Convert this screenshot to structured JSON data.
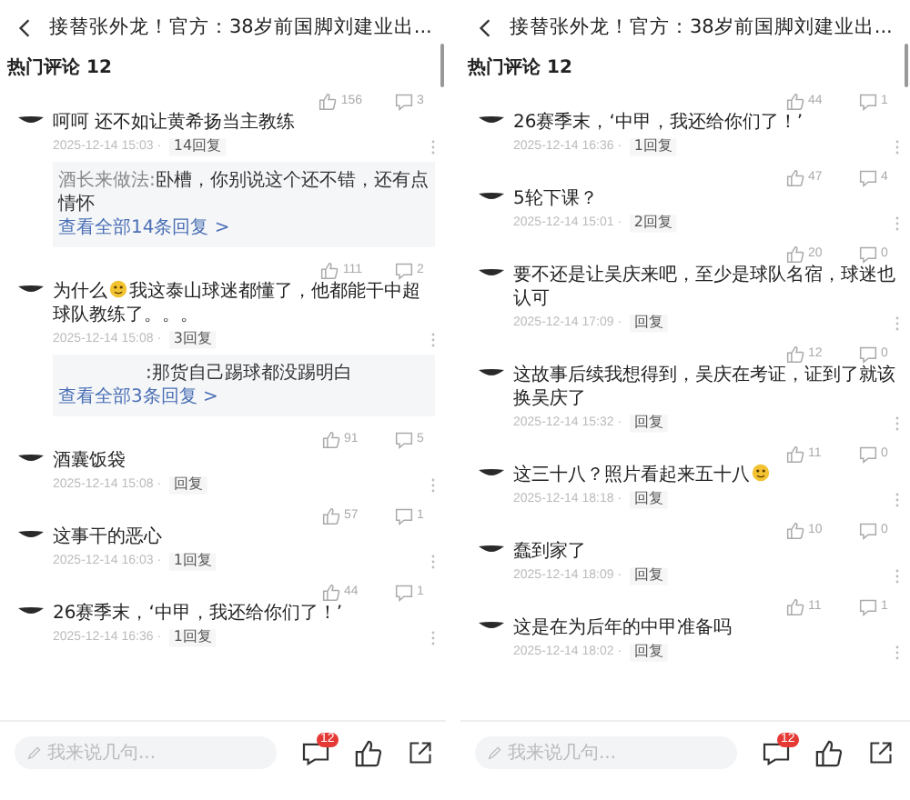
{
  "panels": [
    {
      "title": "接替张外龙！官方：38岁前国脚刘建业出...",
      "section": "热门评论 12",
      "comments": [
        {
          "likes": "156",
          "replies": "3",
          "text": "呵呵 还不如让黄希扬当主教练",
          "emoji": false,
          "date": "2025-12-14 15:03 ·",
          "reply_label": "14回复",
          "preview": {
            "author": "酒长来做法:",
            "text": "卧槽，你别说这个还不错，还有点情怀",
            "more": "查看全部14条回复 >"
          }
        },
        {
          "likes": "111",
          "replies": "2",
          "text": "为什么",
          "emoji": true,
          "text_after": "我这泰山球迷都懂了，他都能干中超球队教练了。。。",
          "date": "2025-12-14 15:08 ·",
          "reply_label": "3回复",
          "preview": {
            "text": ":那货自己踢球都没踢明白",
            "more": "查看全部3条回复 >"
          }
        },
        {
          "likes": "91",
          "replies": "5",
          "text": "酒囊饭袋",
          "emoji": false,
          "date": "2025-12-14 15:08 ·",
          "reply_label": "回复"
        },
        {
          "likes": "57",
          "replies": "1",
          "text": "这事干的恶心",
          "emoji": false,
          "date": "2025-12-14 16:03 ·",
          "reply_label": "1回复"
        },
        {
          "likes": "44",
          "replies": "1",
          "text": "26赛季末，‘中甲，我还给你们了！’",
          "emoji": false,
          "date": "2025-12-14 16:36 ·",
          "reply_label": "1回复"
        }
      ],
      "input": {
        "placeholder": "我来说几句..."
      },
      "badge": "12"
    },
    {
      "title": "接替张外龙！官方：38岁前国脚刘建业出...",
      "section": "热门评论 12",
      "comments": [
        {
          "likes": "44",
          "replies": "1",
          "text": "26赛季末，‘中甲，我还给你们了！’",
          "emoji": false,
          "date": "2025-12-14 16:36 ·",
          "reply_label": "1回复"
        },
        {
          "likes": "47",
          "replies": "4",
          "text": "5轮下课？",
          "emoji": false,
          "date": "2025-12-14 15:01 ·",
          "reply_label": "2回复"
        },
        {
          "likes": "20",
          "replies": "0",
          "text": "要不还是让吴庆来吧，至少是球队名宿，球迷也认可",
          "emoji": false,
          "date": "2025-12-14 17:09 ·",
          "reply_label": "回复"
        },
        {
          "likes": "12",
          "replies": "0",
          "text": "这故事后续我想得到，吴庆在考证，证到了就该换吴庆了",
          "emoji": false,
          "date": "2025-12-14 15:32 ·",
          "reply_label": "回复"
        },
        {
          "likes": "11",
          "replies": "0",
          "text": "这三十八？照片看起来五十八",
          "emoji": true,
          "date": "2025-12-14 18:18 ·",
          "reply_label": "回复"
        },
        {
          "likes": "10",
          "replies": "0",
          "text": "蠢到家了",
          "emoji": false,
          "date": "2025-12-14 18:09 ·",
          "reply_label": "回复"
        },
        {
          "likes": "11",
          "replies": "1",
          "text": "这是在为后年的中甲准备吗",
          "emoji": false,
          "date": "2025-12-14 18:02 ·",
          "reply_label": "回复"
        }
      ],
      "input": {
        "placeholder": "我来说几句..."
      },
      "badge": "12"
    }
  ]
}
